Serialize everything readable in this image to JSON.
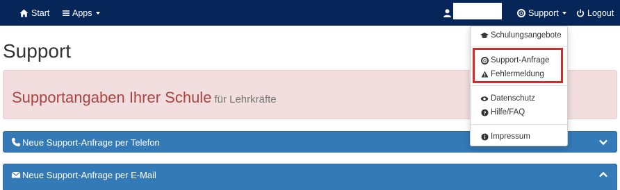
{
  "navbar": {
    "start_label": "Start",
    "apps_label": "Apps",
    "support_label": "Support",
    "logout_label": "Logout",
    "background": "#06265a"
  },
  "page": {
    "title": "Support"
  },
  "alert": {
    "heading": "Supportangaben Ihrer Schule",
    "subheading": "für Lehrkräfte",
    "background": "#f2dede",
    "text_color": "#a94442"
  },
  "panels": [
    {
      "label": "Neue Support-Anfrage per Telefon",
      "icon": "phone-icon",
      "state": "collapsed"
    },
    {
      "label": "Neue Support-Anfrage per E-Mail",
      "icon": "envelope-icon",
      "state": "expanded"
    }
  ],
  "dropdown": {
    "items": [
      {
        "label": "Schulungsangebote",
        "icon": "graduation-cap-icon"
      },
      {
        "label": "Support-Anfrage",
        "icon": "lifebuoy-icon"
      },
      {
        "label": "Fehlermeldung",
        "icon": "warning-icon"
      },
      {
        "label": "Datenschutz",
        "icon": "eye-icon"
      },
      {
        "label": "Hilfe/FAQ",
        "icon": "question-circle-icon"
      },
      {
        "label": "Impressum",
        "icon": "info-circle-icon"
      }
    ],
    "highlight_color": "#d42a2a"
  }
}
